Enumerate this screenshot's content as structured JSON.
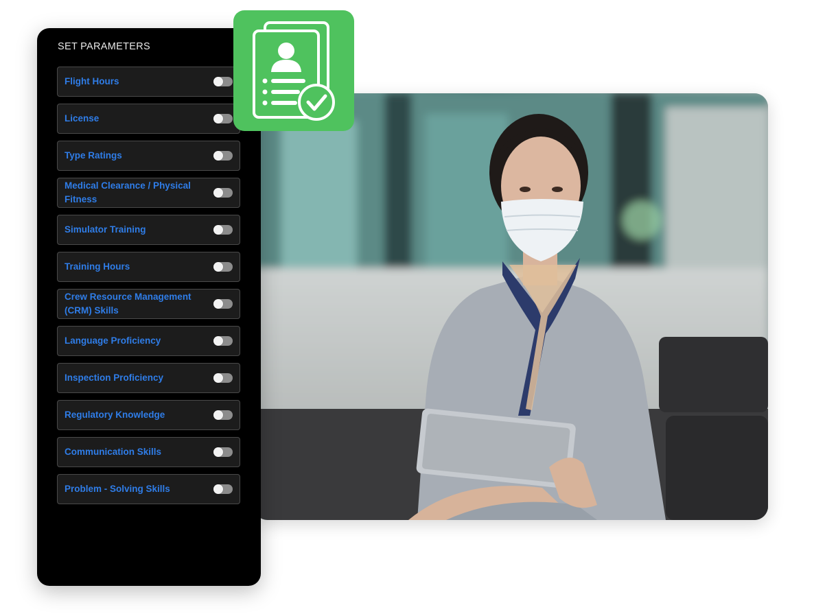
{
  "panel": {
    "title": "SET PARAMETERS",
    "parameters": [
      {
        "label": "Flight Hours",
        "enabled": false
      },
      {
        "label": "License",
        "enabled": false
      },
      {
        "label": "Type Ratings",
        "enabled": false
      },
      {
        "label": "Medical Clearance / Physical Fitness",
        "enabled": false
      },
      {
        "label": "Simulator Training",
        "enabled": false
      },
      {
        "label": "Training Hours",
        "enabled": false
      },
      {
        "label": "Crew Resource Management (CRM) Skills",
        "enabled": false
      },
      {
        "label": "Language Proficiency",
        "enabled": false
      },
      {
        "label": "Inspection Proficiency",
        "enabled": false
      },
      {
        "label": "Regulatory Knowledge",
        "enabled": false
      },
      {
        "label": "Communication Skills",
        "enabled": false
      },
      {
        "label": "Problem - Solving Skills",
        "enabled": false
      }
    ]
  },
  "badge": {
    "icon": "resume-check-icon",
    "color": "#4fc25e"
  },
  "photo": {
    "subject": "photo-icon"
  },
  "colors": {
    "label_blue": "#2f7de8",
    "panel_bg": "#000000",
    "accent_green": "#4fc25e"
  }
}
